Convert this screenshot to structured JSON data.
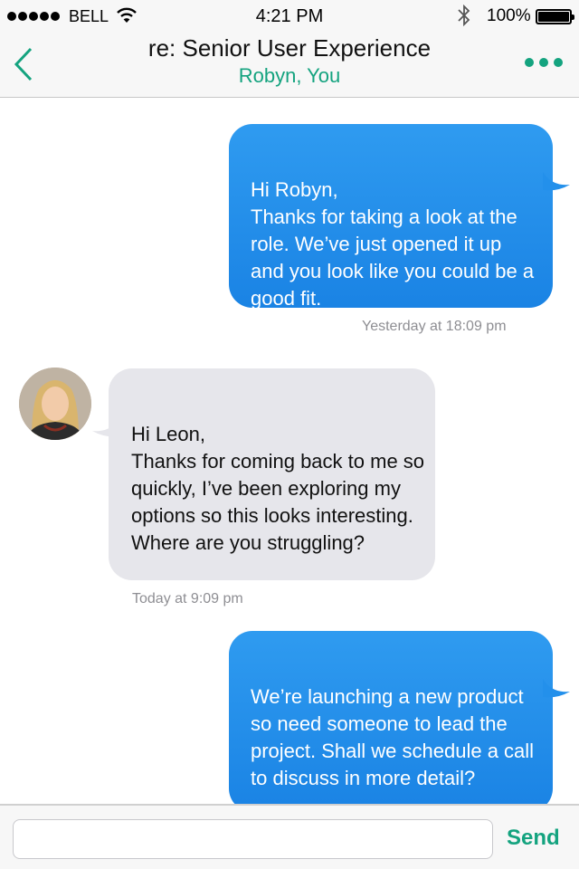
{
  "status_bar": {
    "carrier": "BELL",
    "time": "4:21 PM",
    "battery": "100%"
  },
  "nav": {
    "title": "re: Senior User Experience",
    "subtitle": "Robyn, You"
  },
  "messages": [
    {
      "direction": "outgoing",
      "text": "Hi Robyn,\nThanks for taking a look at the role. We’ve just opened it up and you look like you could be a good fit.",
      "timestamp": "Yesterday at 18:09 pm"
    },
    {
      "direction": "incoming",
      "text": "Hi Leon,\nThanks for coming back to me so quickly, I’ve been exploring my options so this looks interesting. Where are you struggling?",
      "timestamp": "Today at 9:09 pm"
    },
    {
      "direction": "outgoing",
      "text": "We’re launching a new product so need someone to lead the project. Shall we schedule a call to discuss in more detail?",
      "timestamp": ""
    }
  ],
  "composer": {
    "placeholder": "",
    "send_label": "Send"
  },
  "colors": {
    "accent": "#14a37f",
    "outgoing_bubble": "#1f8ae8",
    "incoming_bubble": "#e6e6eb",
    "timestamp": "#8e8e93"
  },
  "icons": [
    "signal-dots-icon",
    "wifi-icon",
    "bluetooth-icon",
    "battery-icon",
    "back-chevron-icon",
    "more-dots-icon"
  ]
}
